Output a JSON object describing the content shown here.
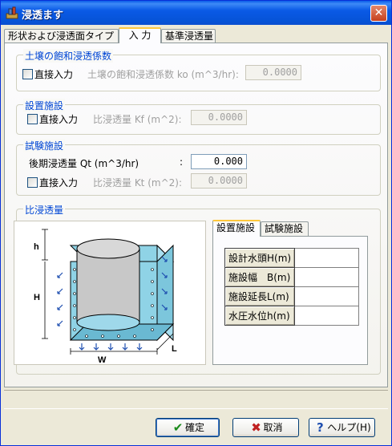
{
  "window": {
    "title": "浸透ます",
    "close_label": "✕"
  },
  "tabs": [
    {
      "label": "形状および浸透面タイプ"
    },
    {
      "label": "入 力"
    },
    {
      "label": "基準浸透量"
    }
  ],
  "soil_group": {
    "title": "土壌の飽和浸透係数",
    "checkbox_label": "直接入力",
    "field_label": "土壌の飽和浸透係数 ko (m^3/hr):",
    "value": "0.0000"
  },
  "facility_group": {
    "title": "設置施設",
    "checkbox_label": "直接入力",
    "field_label": "比浸透量 Kf (m^2):",
    "value": "0.0000"
  },
  "test_group": {
    "title": "試験施設",
    "later_label": "後期浸透量 Qt (m^3/hr)",
    "colon": ":",
    "later_value": "0.000",
    "checkbox_label": "直接入力",
    "field_label": "比浸透量 Kt (m^2):",
    "value": "0.0000"
  },
  "specific_group": {
    "title": "比浸透量",
    "diagram_labels": {
      "h": "h",
      "H": "H",
      "W": "W",
      "L": "L"
    },
    "subtabs": [
      {
        "label": "設置施設"
      },
      {
        "label": "試験施設"
      }
    ],
    "rows": [
      {
        "label": "設計水頭H(m)",
        "value": ""
      },
      {
        "label": "施設幅　B(m)",
        "value": ""
      },
      {
        "label": "施設延長L(m)",
        "value": ""
      },
      {
        "label": "水圧水位h(m)",
        "value": ""
      }
    ]
  },
  "buttons": {
    "ok": "確定",
    "cancel": "取消",
    "help": "ヘルプ(H)"
  },
  "colors": {
    "title_bar": "#0a5ae6",
    "group_title": "#0046d5",
    "diagram_fill": "#8fd3e6",
    "arrow": "#1f4fb0"
  }
}
